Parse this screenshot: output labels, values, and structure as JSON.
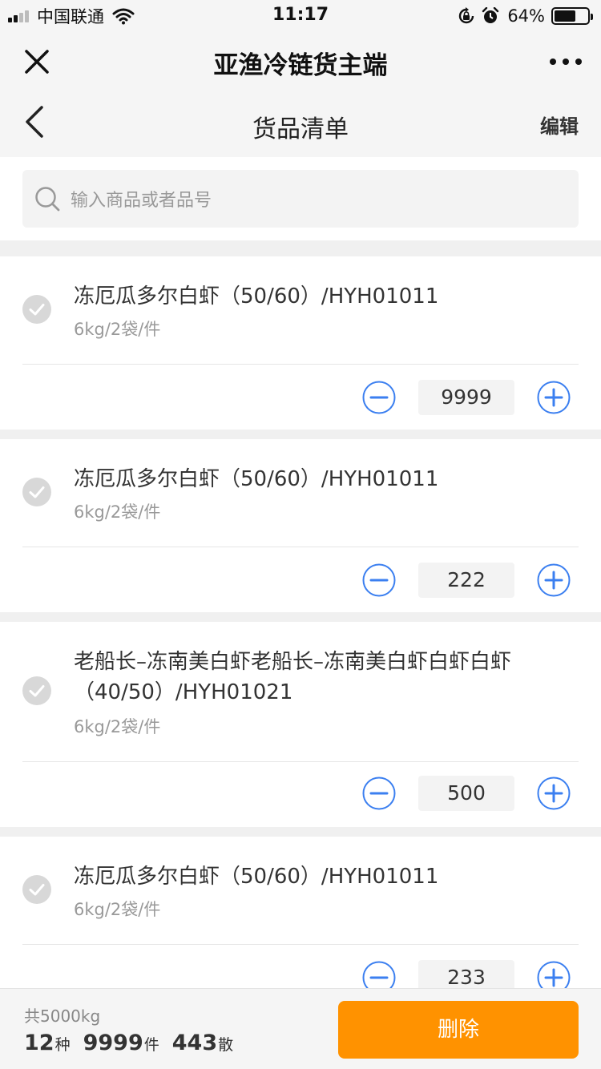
{
  "status_bar": {
    "carrier": "中国联通",
    "time": "11:17",
    "battery_percent": "64%",
    "battery_level": 0.64,
    "icons": [
      "signal-icon",
      "wifi-icon",
      "rotation-lock-icon",
      "alarm-icon",
      "battery-icon"
    ]
  },
  "app_bar": {
    "title": "亚渔冷链货主端",
    "icons": [
      "close-icon",
      "more-icon"
    ]
  },
  "nav": {
    "title": "货品清单",
    "edit_label": "编辑",
    "icons": [
      "back-icon"
    ]
  },
  "search": {
    "placeholder": "输入商品或者品号",
    "icon": "search-icon"
  },
  "items": [
    {
      "name": "冻厄瓜多尔白虾（50/60）/HYH01011",
      "spec": "6kg/2袋/件",
      "qty": "9999"
    },
    {
      "name": "冻厄瓜多尔白虾（50/60）/HYH01011",
      "spec": "6kg/2袋/件",
      "qty": "222"
    },
    {
      "name": "老船长–冻南美白虾老船长–冻南美白虾白虾白虾（40/50）/HYH01021",
      "spec": "6kg/2袋/件",
      "qty": "500"
    },
    {
      "name": "冻厄瓜多尔白虾（50/60）/HYH01011",
      "spec": "6kg/2袋/件",
      "qty": "233"
    }
  ],
  "summary": {
    "weight": "共5000kg",
    "kinds": "12",
    "kinds_unit": "种",
    "pieces": "9999",
    "pieces_unit": "件",
    "loose": "443",
    "loose_unit": "散"
  },
  "delete_label": "删除",
  "colors": {
    "accent_blue": "#3b7ff0",
    "delete_orange": "#ff9200",
    "check_gray": "#d8d8d8"
  }
}
